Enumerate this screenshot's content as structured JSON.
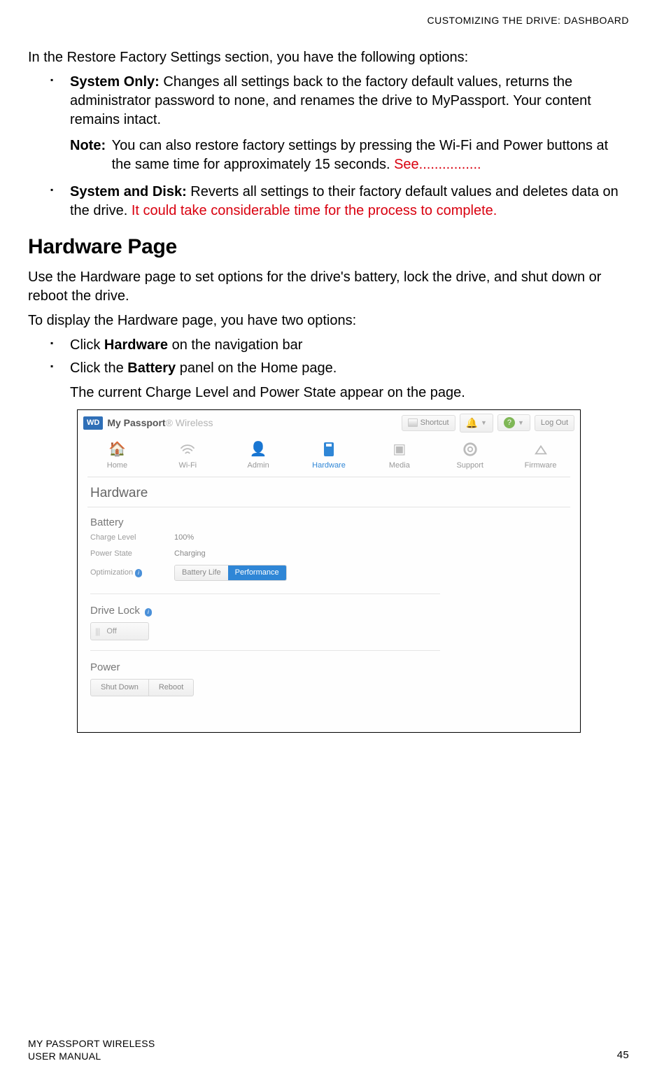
{
  "header": {
    "running_head": "CUSTOMIZING THE DRIVE: DASHBOARD"
  },
  "body": {
    "intro": "In the Restore Factory Settings section, you have the following options:",
    "bullet1_label": "System Only:",
    "bullet1_text": " Changes all settings back to the factory default values, returns the administrator password to none, and renames the drive to MyPassport. Your content remains intact.",
    "note_label": "Note:",
    "note_text": " You can also restore factory settings by pressing the Wi-Fi and Power buttons at the same time for approximately 15 seconds. ",
    "note_link": "See................",
    "bullet2_label": "System and Disk:",
    "bullet2_text": " Reverts all settings to their factory default values and deletes data on the drive. ",
    "bullet2_red": "It could take considerable time for the process to complete.",
    "section_title": "Hardware Page",
    "hw_intro": "Use the Hardware page to set options for the drive's battery, lock the drive, and shut down or reboot the drive.",
    "hw_display": "To display the Hardware page, you have two options:",
    "hw_opt1_pre": "Click ",
    "hw_opt1_bold": "Hardware",
    "hw_opt1_post": " on the navigation bar",
    "hw_opt2_pre": "Click the ",
    "hw_opt2_bold": "Battery",
    "hw_opt2_post": " panel on the Home page.",
    "hw_result": "The current Charge Level and Power State appear on the page."
  },
  "screenshot": {
    "logo": "WD",
    "brand_bold": "My Passport",
    "brand_light": "® Wireless",
    "topbar": {
      "shortcut": "Shortcut",
      "help": "?",
      "logout": "Log Out"
    },
    "nav": {
      "home": "Home",
      "wifi": "Wi-Fi",
      "admin": "Admin",
      "hardware": "Hardware",
      "media": "Media",
      "support": "Support",
      "firmware": "Firmware"
    },
    "panel_title": "Hardware",
    "battery": {
      "title": "Battery",
      "charge_k": "Charge Level",
      "charge_v": "100%",
      "power_k": "Power State",
      "power_v": "Charging",
      "opt_k": "Optimization",
      "seg_a": "Battery Life",
      "seg_b": "Performance"
    },
    "drivelock": {
      "title": "Drive Lock",
      "state": "Off"
    },
    "power": {
      "title": "Power",
      "shutdown": "Shut Down",
      "reboot": "Reboot"
    }
  },
  "footer": {
    "line1": "MY PASSPORT WIRELESS",
    "line2": "USER MANUAL",
    "page": "45"
  }
}
